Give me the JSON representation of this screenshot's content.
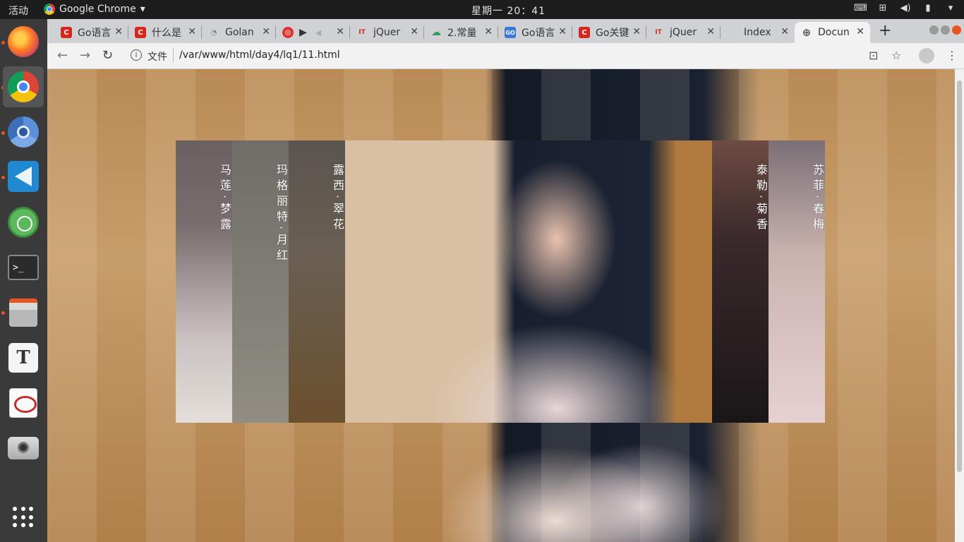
{
  "system": {
    "activities": "活动",
    "app_name": "Google Chrome",
    "clock": "星期一 20：41"
  },
  "dock": {
    "items": [
      {
        "name": "firefox-icon"
      },
      {
        "name": "chrome-icon"
      },
      {
        "name": "chromium-icon"
      },
      {
        "name": "vscode-icon"
      },
      {
        "name": "atom-icon"
      },
      {
        "name": "terminal-icon",
        "glyph": ">_"
      },
      {
        "name": "files-icon"
      },
      {
        "name": "text-editor-icon",
        "glyph": "T"
      },
      {
        "name": "pdf-reader-icon"
      },
      {
        "name": "camera-icon"
      },
      {
        "name": "show-apps-icon"
      }
    ]
  },
  "browser": {
    "tabs": [
      {
        "title": "Go语言",
        "favicon": "C",
        "favicon_color": "#d7261c"
      },
      {
        "title": "什么是",
        "favicon": "C",
        "favicon_color": "#d7261c"
      },
      {
        "title": "Golan",
        "favicon": "",
        "favicon_color": "#9a9a9a"
      },
      {
        "title": "",
        "favicon": "◎",
        "favicon_color": "#e0312b",
        "audio": true
      },
      {
        "title": "jQuer",
        "favicon": "IT",
        "favicon_color": "#d7261c"
      },
      {
        "title": "2.常量",
        "favicon": "☁",
        "favicon_color": "#2e9d57"
      },
      {
        "title": "Go语言",
        "favicon": "GO",
        "favicon_color": "#3b78d8"
      },
      {
        "title": "Go关键",
        "favicon": "C",
        "favicon_color": "#d7261c"
      },
      {
        "title": "jQuer",
        "favicon": "IT",
        "favicon_color": "#d7261c"
      },
      {
        "title": "Index",
        "favicon": "",
        "favicon_color": "#9a9a9a"
      },
      {
        "title": "Docun",
        "favicon": "⊕",
        "favicon_color": "#555555",
        "active": true
      }
    ],
    "address": {
      "security_label": "文件",
      "url": "/var/www/html/day4/lq1/11.html"
    }
  },
  "gallery": {
    "panels": [
      {
        "name": "马莲·梦露",
        "expanded": false
      },
      {
        "name": "玛格丽特·月红",
        "expanded": false
      },
      {
        "name": "露西·翠花",
        "expanded": false
      },
      {
        "name": "",
        "expanded": true
      },
      {
        "name": "泰勒·菊香",
        "expanded": false
      },
      {
        "name": "苏菲·春梅",
        "expanded": false
      }
    ]
  },
  "colors": {
    "accent_dock_dot": "#e95420",
    "topbar": "#1d1d1d",
    "dock": "#3a3a3a"
  }
}
